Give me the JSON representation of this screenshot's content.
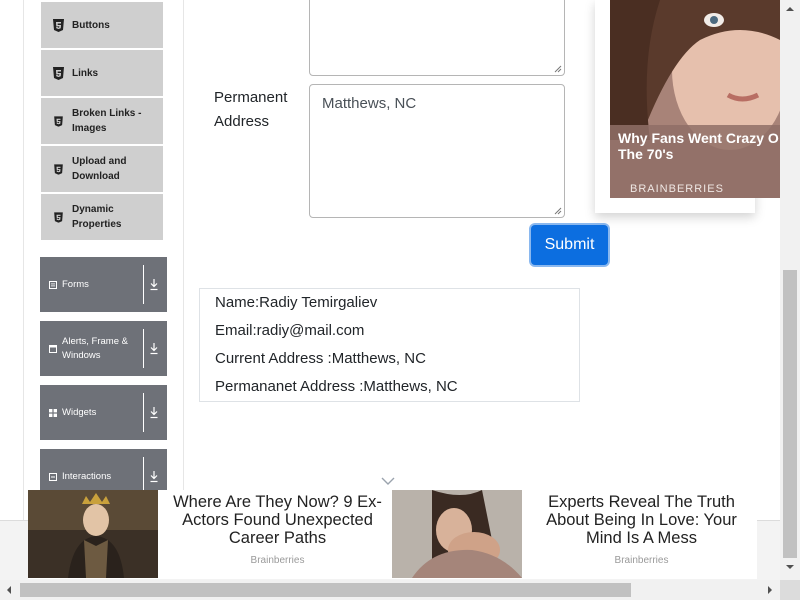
{
  "sidebar": {
    "subitems": [
      {
        "label": "Buttons",
        "icon": "html5-icon"
      },
      {
        "label": "Links",
        "icon": "html5-icon"
      },
      {
        "label": "Broken Links - Images",
        "icon": "html5-icon"
      },
      {
        "label": "Upload and Download",
        "icon": "html5-icon"
      },
      {
        "label": "Dynamic Properties",
        "icon": "html5-icon"
      }
    ],
    "groups": [
      {
        "label": "Forms",
        "icon": "form-icon"
      },
      {
        "label": "Alerts, Frame & Windows",
        "icon": "window-icon"
      },
      {
        "label": "Widgets",
        "icon": "widgets-icon"
      },
      {
        "label": "Interactions",
        "icon": "interactions-icon"
      }
    ]
  },
  "form": {
    "permanent_address_label": "Permanent Address",
    "permanent_address_value": "Matthews, NC",
    "current_address_value": "",
    "submit_label": "Submit"
  },
  "output": {
    "name": "Name:Radiy Temirgaliev",
    "email": "Email:radiy@mail.com",
    "current_address": "Current Address :Matthews, NC",
    "permanent_address": "Permananet Address :Matthews, NC"
  },
  "side_ad": {
    "headline": "Why Fans Went Crazy O\nThe 70's",
    "brand": "BRAINBERRIES"
  },
  "bottom_ads": [
    {
      "title": "Where Are They Now? 9 Ex-Actors Found Unexpected Career Paths",
      "brand": "Brainberries"
    },
    {
      "title": "Experts Reveal The Truth About Being In Love: Your Mind Is A Mess",
      "brand": "Brainberries"
    }
  ],
  "colors": {
    "submit": "#0c6ee0",
    "sidebar_group": "#6e7178",
    "sidebar_subitem": "#cfcfcf"
  }
}
